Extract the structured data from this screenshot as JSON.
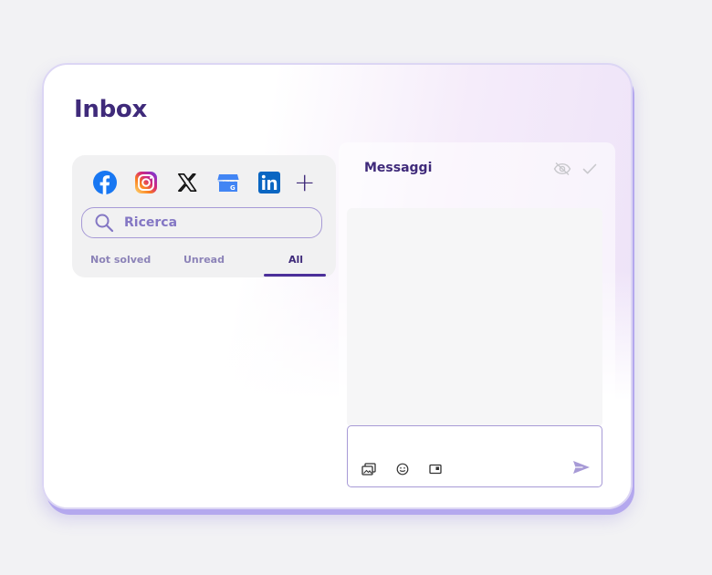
{
  "page": {
    "title": "Inbox"
  },
  "social_icons": [
    {
      "name": "facebook-icon",
      "color": "#1877f2"
    },
    {
      "name": "instagram-icon",
      "color": "#e1306c"
    },
    {
      "name": "x-icon",
      "color": "#111111"
    },
    {
      "name": "google-business-icon",
      "color": "#4285f4"
    },
    {
      "name": "linkedin-icon",
      "color": "#0a66c2"
    }
  ],
  "add_label": "+",
  "search": {
    "placeholder": "Ricerca",
    "value": ""
  },
  "tabs": [
    {
      "label": "Not solved",
      "active": false
    },
    {
      "label": "Unread",
      "active": false
    },
    {
      "label": "All",
      "active": true
    }
  ],
  "messages": {
    "title": "Messaggi",
    "header_icons": [
      "eye-off-icon",
      "check-icon"
    ],
    "composer_placeholder": "",
    "tools": [
      "media-icon",
      "emoji-icon",
      "folder-icon"
    ],
    "send_icon": "send-icon"
  },
  "colors": {
    "accent": "#3f2a7a",
    "border": "#a79ad6",
    "muted": "#8c83b8"
  }
}
